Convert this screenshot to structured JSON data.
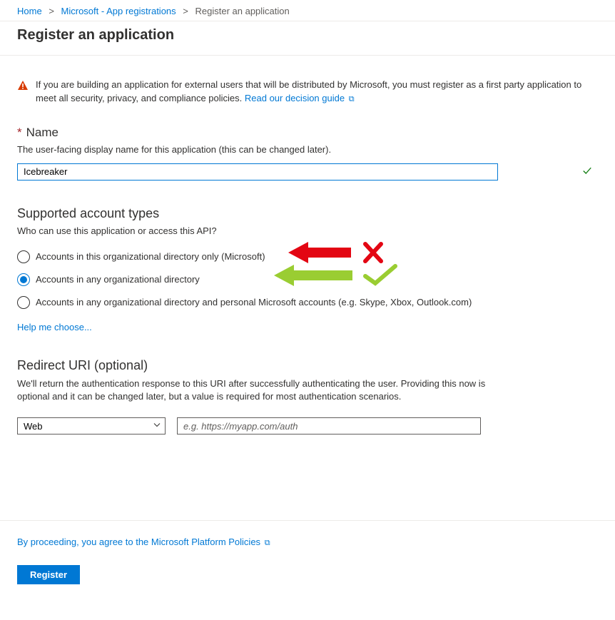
{
  "breadcrumb": {
    "home": "Home",
    "parent": "Microsoft - App registrations",
    "current": "Register an application"
  },
  "page_title": "Register an application",
  "banner": {
    "text": "If you are building an application for external users that will be distributed by Microsoft, you must register as a first party application to meet all security, privacy, and compliance policies. ",
    "link": "Read our decision guide"
  },
  "name_field": {
    "label": "Name",
    "desc": "The user-facing display name for this application (this can be changed later).",
    "value": "Icebreaker"
  },
  "account_types": {
    "heading": "Supported account types",
    "subtext": "Who can use this application or access this API?",
    "options": [
      "Accounts in this organizational directory only (Microsoft)",
      "Accounts in any organizational directory",
      "Accounts in any organizational directory and personal Microsoft accounts (e.g. Skype, Xbox, Outlook.com)"
    ],
    "selected": 1,
    "help_link": "Help me choose..."
  },
  "redirect": {
    "heading": "Redirect URI (optional)",
    "subtext": "We'll return the authentication response to this URI after successfully authenticating the user. Providing this now is optional and it can be changed later, but a value is required for most authentication scenarios.",
    "type_selected": "Web",
    "uri_placeholder": "e.g. https://myapp.com/auth"
  },
  "footer": {
    "policy_text": "By proceeding, you agree to the Microsoft Platform Policies",
    "register_label": "Register"
  }
}
